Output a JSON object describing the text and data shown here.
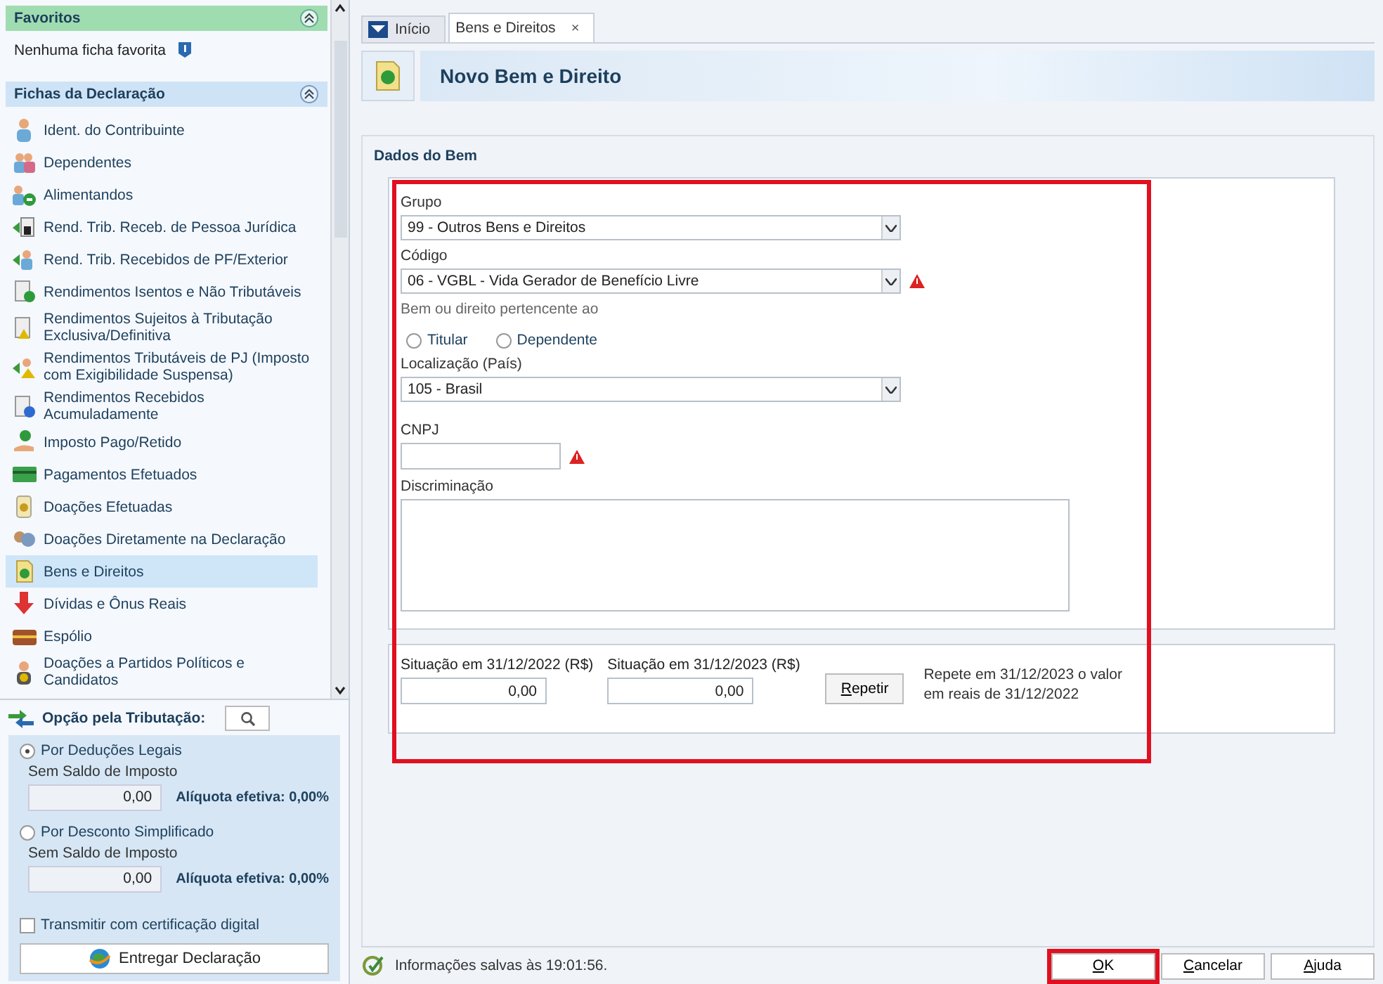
{
  "sidebar": {
    "favorites": {
      "title": "Favoritos",
      "empty_text": "Nenhuma ficha favorita"
    },
    "fichas": {
      "title": "Fichas da Declaração",
      "items": [
        {
          "label": "Ident. do Contribuinte",
          "selected": false
        },
        {
          "label": "Dependentes",
          "selected": false
        },
        {
          "label": "Alimentandos",
          "selected": false
        },
        {
          "label": "Rend. Trib. Receb. de Pessoa Jurídica",
          "selected": false
        },
        {
          "label": "Rend. Trib. Recebidos de PF/Exterior",
          "selected": false
        },
        {
          "label": "Rendimentos Isentos e Não Tributáveis",
          "selected": false
        },
        {
          "label": "Rendimentos Sujeitos à Tributação Exclusiva/Definitiva",
          "selected": false
        },
        {
          "label": "Rendimentos Tributáveis de PJ (Imposto com Exigibilidade Suspensa)",
          "selected": false
        },
        {
          "label": "Rendimentos Recebidos Acumuladamente",
          "selected": false
        },
        {
          "label": "Imposto Pago/Retido",
          "selected": false
        },
        {
          "label": "Pagamentos Efetuados",
          "selected": false
        },
        {
          "label": "Doações Efetuadas",
          "selected": false
        },
        {
          "label": "Doações Diretamente na Declaração",
          "selected": false
        },
        {
          "label": "Bens e Direitos",
          "selected": true
        },
        {
          "label": "Dívidas e Ônus Reais",
          "selected": false
        },
        {
          "label": "Espólio",
          "selected": false
        },
        {
          "label": "Doações a Partidos Políticos e Candidatos",
          "selected": false
        }
      ]
    },
    "tributacao": {
      "title": "Opção pela Tributação:",
      "options": [
        {
          "label": "Por Deduções Legais",
          "selected": true,
          "caption": "Sem Saldo de Imposto",
          "value": "0,00",
          "rate": "Alíquota efetiva: 0,00%"
        },
        {
          "label": "Por Desconto Simplificado",
          "selected": false,
          "caption": "Sem Saldo de Imposto",
          "value": "0,00",
          "rate": "Alíquota efetiva: 0,00%"
        }
      ],
      "certificate": {
        "label": "Transmitir com certificação digital",
        "checked": false
      },
      "submit": "Entregar Declaração"
    }
  },
  "tabs": [
    {
      "label": "Início",
      "selected": false,
      "closable": false
    },
    {
      "label": "Bens e Direitos",
      "selected": true,
      "closable": true
    }
  ],
  "close_glyph": "×",
  "page_title": "Novo Bem e Direito",
  "form": {
    "title": "Dados do Bem",
    "highlight": true,
    "grupo": {
      "label": "Grupo",
      "value": "99 - Outros Bens e Direitos",
      "warning": false
    },
    "codigo": {
      "label": "Código",
      "value": "06 - VGBL - Vida Gerador de Benefício Livre",
      "warning": true
    },
    "owner": {
      "label": "Bem ou direito pertencente ao",
      "options": [
        {
          "label": "Titular",
          "selected": false
        },
        {
          "label": "Dependente",
          "selected": false
        }
      ]
    },
    "pais": {
      "label": "Localização (País)",
      "value": "105 - Brasil",
      "warning": false
    },
    "cnpj": {
      "label": "CNPJ",
      "warning": true
    },
    "discriminacao": {
      "label": "Discriminação"
    },
    "situacao": [
      {
        "label": "Situação em 31/12/2022 (R$)",
        "value": "0,00"
      },
      {
        "label": "Situação em 31/12/2023 (R$)",
        "value": "0,00"
      }
    ],
    "repeat": {
      "label": "Repetir",
      "note": "Repete em 31/12/2023 o valor em reais de 31/12/2022"
    }
  },
  "status": "Informações salvas às 19:01:56.",
  "buttons": [
    {
      "label": "OK",
      "highlight": true
    },
    {
      "label": "Cancelar",
      "highlight": false
    },
    {
      "label": "Ajuda",
      "highlight": false
    }
  ]
}
